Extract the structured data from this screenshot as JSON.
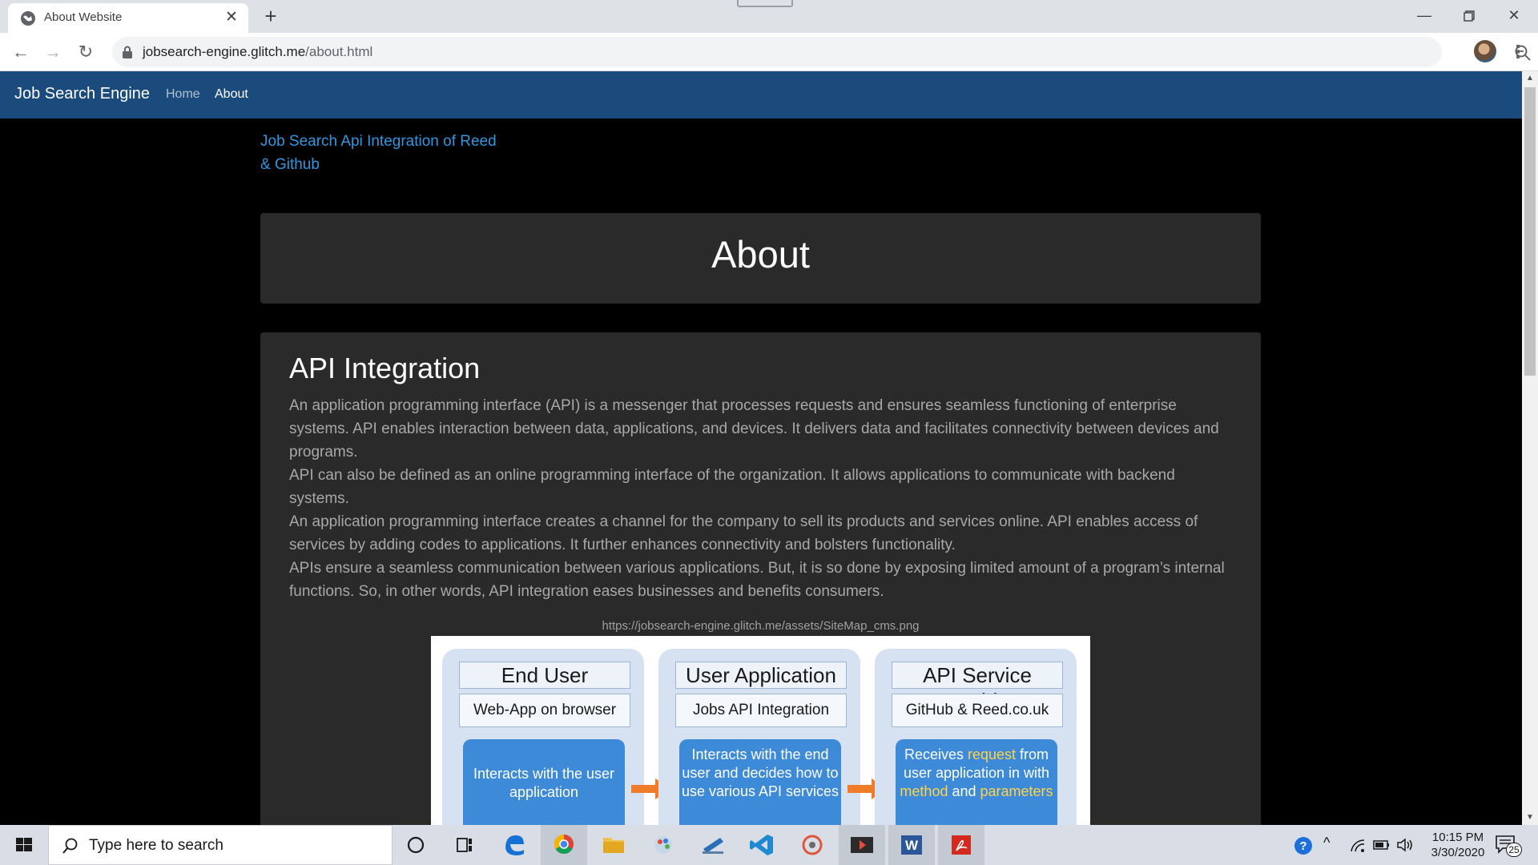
{
  "browser": {
    "tab_title": "About Website",
    "url_host": "jobsearch-engine.glitch.me",
    "url_path": "/about.html"
  },
  "navbar": {
    "brand": "Job Search Engine",
    "links": [
      "Home",
      "About"
    ]
  },
  "page": {
    "subtitle_link": "Job Search Api Integration of Reed & Github",
    "jumbotron_heading": "About",
    "card_title": "API Integration",
    "paragraphs": [
      "An application programming interface (API) is a messenger that processes requests and ensures seamless functioning of enterprise systems. API enables interaction between data, applications, and devices. It delivers data and facilitates connectivity between devices and programs.",
      "API can also be defined as an online programming interface of the organization. It allows applications to communicate with backend systems.",
      "An application programming interface creates a channel for the company to sell its products and services online. API enables access of services by adding codes to applications. It further enhances connectivity and bolsters functionality.",
      "APIs ensure a seamless communication between various applications. But, it is so done by exposing limited amount of a program’s internal functions. So, in other words, API integration eases businesses and benefits consumers."
    ],
    "image_caption": "https://jobsearch-engine.glitch.me/assets/SiteMap_cms.png"
  },
  "diagram": {
    "columns": [
      {
        "title": "End User",
        "subtitle": "Web-App on browser",
        "box_parts": [
          "Interacts with the user application"
        ]
      },
      {
        "title": "User Application",
        "subtitle": "Jobs API Integration",
        "box_parts": [
          "Interacts with the end user and decides how to use various API services"
        ]
      },
      {
        "title": "API Service Provider",
        "subtitle": "GitHub & Reed.co.uk",
        "box_parts": [
          "Receives ",
          "request",
          " from user application in with ",
          "method",
          " and ",
          "parameters"
        ]
      }
    ]
  },
  "taskbar": {
    "search_placeholder": "Type here to search",
    "time": "10:15 PM",
    "date": "3/30/2020",
    "notification_count": "25"
  },
  "colors": {
    "navbar": "#1b4a7c",
    "link": "#2f97e0",
    "card": "#2a2a2a",
    "diagram_box": "#3d8ad8",
    "highlight": "#ffd34a",
    "arrow": "#f07c2a"
  }
}
